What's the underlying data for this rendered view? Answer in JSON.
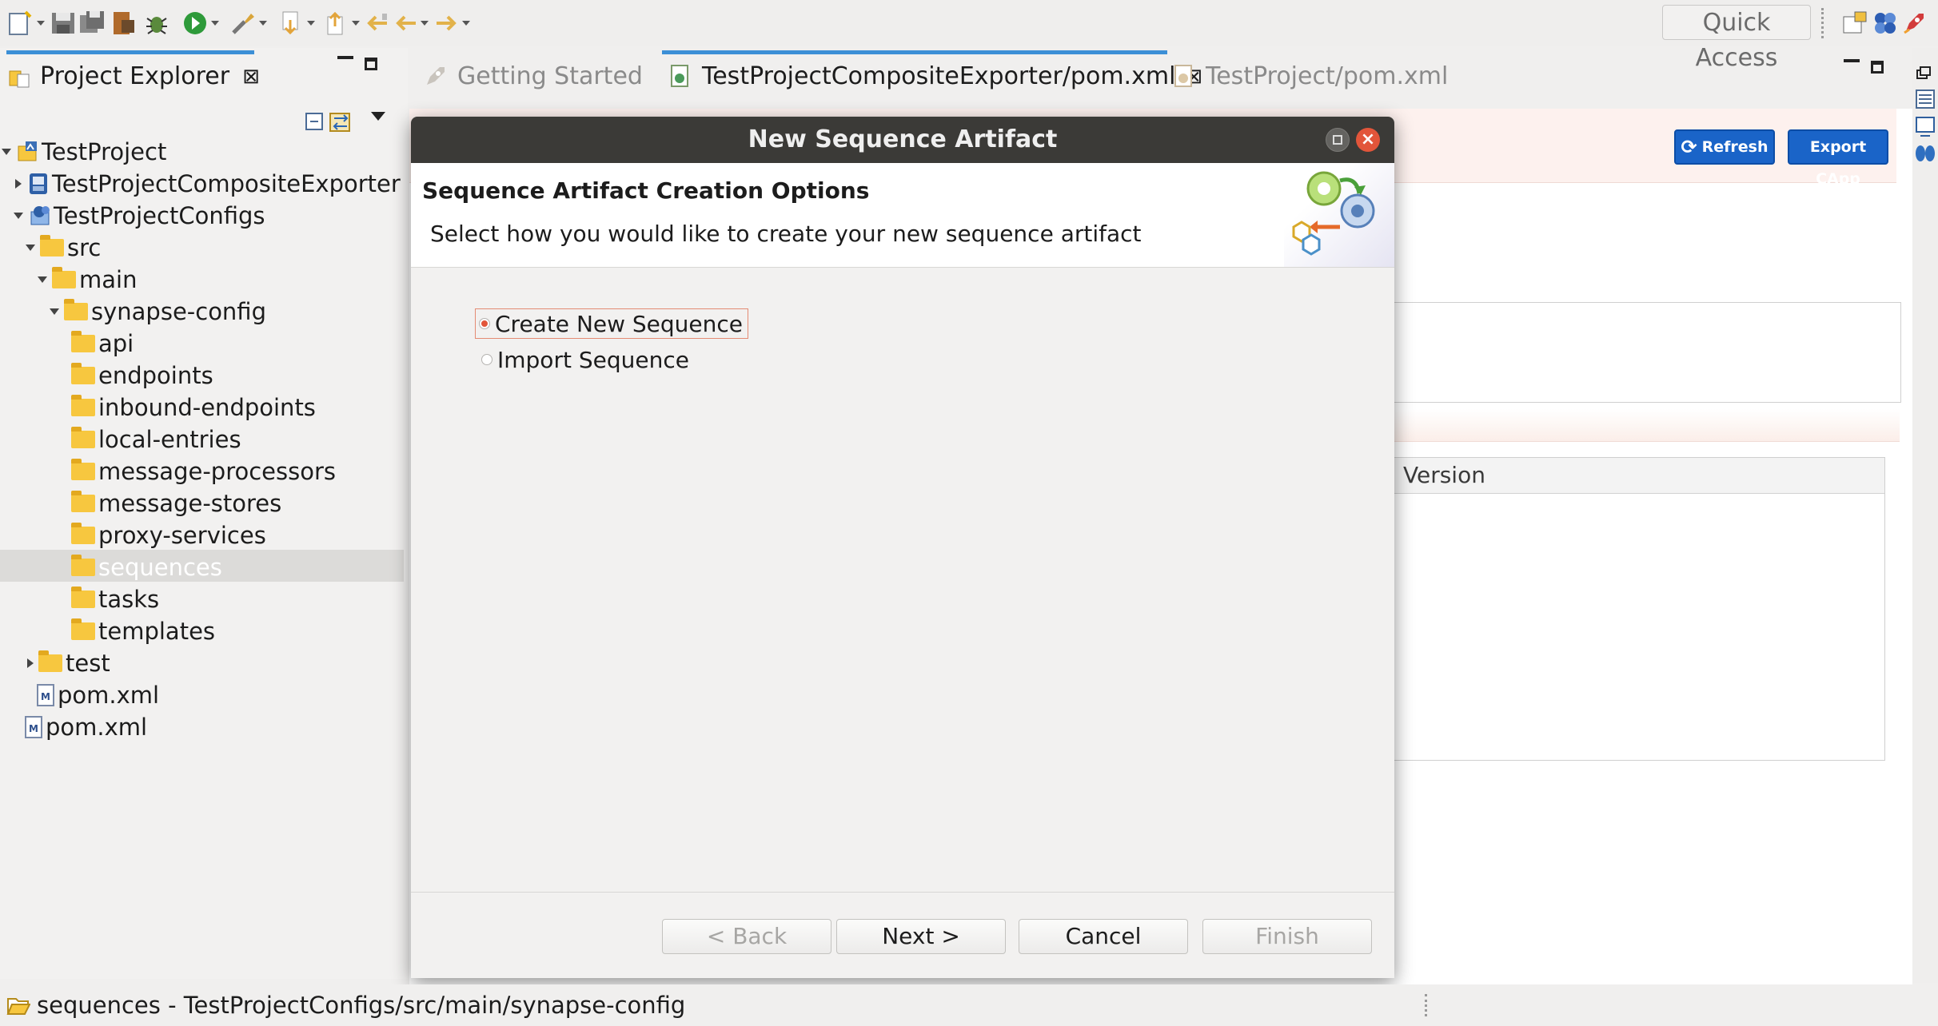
{
  "toolbar": {
    "quick_access": "Quick Access"
  },
  "project_explorer": {
    "title": "Project Explorer",
    "tree": [
      {
        "label": "TestProject",
        "depth": 0,
        "expanded": true,
        "icon": "project-icon"
      },
      {
        "label": "TestProjectCompositeExporter",
        "depth": 1,
        "expanded": false,
        "icon": "composite-exporter-icon"
      },
      {
        "label": "TestProjectConfigs",
        "depth": 1,
        "expanded": true,
        "icon": "config-project-icon"
      },
      {
        "label": "src",
        "depth": 2,
        "expanded": true,
        "icon": "folder-icon"
      },
      {
        "label": "main",
        "depth": 3,
        "expanded": true,
        "icon": "folder-icon"
      },
      {
        "label": "synapse-config",
        "depth": 4,
        "expanded": true,
        "icon": "folder-icon"
      },
      {
        "label": "api",
        "depth": 5,
        "icon": "folder-icon"
      },
      {
        "label": "endpoints",
        "depth": 5,
        "icon": "folder-icon"
      },
      {
        "label": "inbound-endpoints",
        "depth": 5,
        "icon": "folder-icon"
      },
      {
        "label": "local-entries",
        "depth": 5,
        "icon": "folder-icon"
      },
      {
        "label": "message-processors",
        "depth": 5,
        "icon": "folder-icon"
      },
      {
        "label": "message-stores",
        "depth": 5,
        "icon": "folder-icon"
      },
      {
        "label": "proxy-services",
        "depth": 5,
        "icon": "folder-icon"
      },
      {
        "label": "sequences",
        "depth": 5,
        "icon": "folder-icon",
        "selected": true
      },
      {
        "label": "tasks",
        "depth": 5,
        "icon": "folder-icon"
      },
      {
        "label": "templates",
        "depth": 5,
        "icon": "folder-icon"
      },
      {
        "label": "test",
        "depth": 2,
        "expanded": false,
        "icon": "folder-icon"
      },
      {
        "label": "pom.xml",
        "depth": 2,
        "icon": "maven-file-icon"
      },
      {
        "label": "pom.xml",
        "depth": 1,
        "icon": "maven-file-icon"
      }
    ]
  },
  "editor": {
    "tabs": [
      {
        "label": "Getting Started",
        "active": false
      },
      {
        "label": "TestProjectCompositeExporter/pom.xml",
        "active": true
      },
      {
        "label": "TestProject/pom.xml",
        "active": false
      }
    ],
    "refresh_label": "Refresh",
    "export_label": "Export CApp",
    "version_header": "Version"
  },
  "dialog": {
    "title": "New Sequence Artifact",
    "header_title": "Sequence Artifact Creation Options",
    "header_description": "Select how you would like to create your new sequence artifact",
    "options": [
      {
        "label": "Create New Sequence",
        "selected": true
      },
      {
        "label": "Import Sequence",
        "selected": false
      }
    ],
    "buttons": {
      "back": "< Back",
      "next": "Next >",
      "cancel": "Cancel",
      "finish": "Finish"
    }
  },
  "statusbar": {
    "text": "sequences - TestProjectConfigs/src/main/synapse-config"
  }
}
